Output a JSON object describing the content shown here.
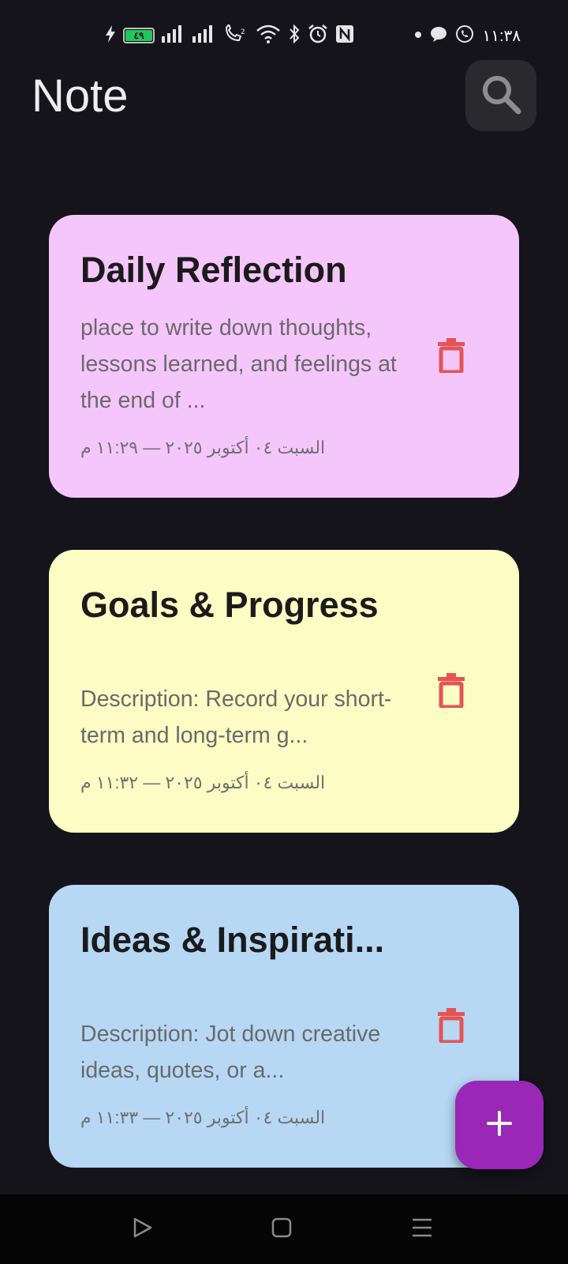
{
  "status_bar": {
    "time": "١١:٣٨",
    "battery_level": "٤٩",
    "icons": [
      "signal-icon",
      "signal-icon",
      "wifi-call-icon",
      "wifi-icon",
      "bluetooth-icon",
      "alarm-icon",
      "nfc-icon",
      "dot-icon",
      "chat-bubble-icon",
      "whatsapp-icon"
    ]
  },
  "header": {
    "title": "Note",
    "search_icon": "search-icon"
  },
  "notes": [
    {
      "title": "Daily Reflection",
      "description": "place to write down thoughts, lessons learned, and feelings at the end of ...",
      "date": "السبت ٠٤ أكتوبر ٢٠٢٥ — ١١:٢٩ م",
      "color": "#f5c6fb",
      "delete_icon": "trash-icon"
    },
    {
      "title": "Goals & Progress",
      "description": "Description: Record your short-term and long-term g...",
      "date": "السبت ٠٤ أكتوبر ٢٠٢٥ — ١١:٣٢ م",
      "color": "#fdfcc4",
      "delete_icon": "trash-icon"
    },
    {
      "title": "Ideas & Inspirati...",
      "description": "Description: Jot down creative ideas, quotes, or a...",
      "date": "السبت ٠٤ أكتوبر ٢٠٢٥ — ١١:٣٣ م",
      "color": "#b6d8f5",
      "delete_icon": "trash-icon"
    }
  ],
  "fab": {
    "icon": "plus-icon"
  },
  "nav_bar": {
    "icons": [
      "back-icon",
      "home-icon",
      "recents-icon"
    ]
  },
  "colors": {
    "background": "#16141b",
    "accent": "#9a27b5",
    "delete": "#e55353"
  }
}
